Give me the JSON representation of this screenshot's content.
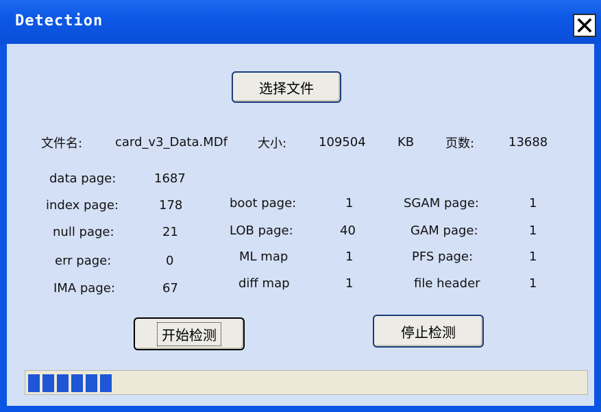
{
  "window": {
    "title": "Detection",
    "close_label": "✕",
    "colors": {
      "titlebar": "#0a54e3",
      "client": "#d4e0f6",
      "progress_fill": "#1e56d6"
    }
  },
  "select_file_button": "选择文件",
  "file_info": {
    "name_label": "文件名:",
    "name_value": "card_v3_Data.MDf",
    "size_label": "大小:",
    "size_value": "109504",
    "size_unit": "KB",
    "pages_label": "页数:",
    "pages_value": "13688"
  },
  "stats": {
    "col1": [
      {
        "label": "data page:",
        "value": "1687"
      },
      {
        "label": "index page:",
        "value": "178"
      },
      {
        "label": "null page:",
        "value": "21"
      },
      {
        "label": "err page:",
        "value": "0"
      },
      {
        "label": "IMA page:",
        "value": "67"
      }
    ],
    "col2": [
      {
        "label": "boot page:",
        "value": "1"
      },
      {
        "label": "LOB page:",
        "value": "40"
      },
      {
        "label": "ML map",
        "value": "1"
      },
      {
        "label": "diff map",
        "value": "1"
      }
    ],
    "col3": [
      {
        "label": "SGAM page:",
        "value": "1"
      },
      {
        "label": "GAM page:",
        "value": "1"
      },
      {
        "label": "PFS page:",
        "value": "1"
      },
      {
        "label": "file header",
        "value": "1"
      }
    ]
  },
  "buttons": {
    "start": "开始检测",
    "stop": "停止检测"
  },
  "progress": {
    "filled_segments": 6,
    "fraction": 0.17
  }
}
